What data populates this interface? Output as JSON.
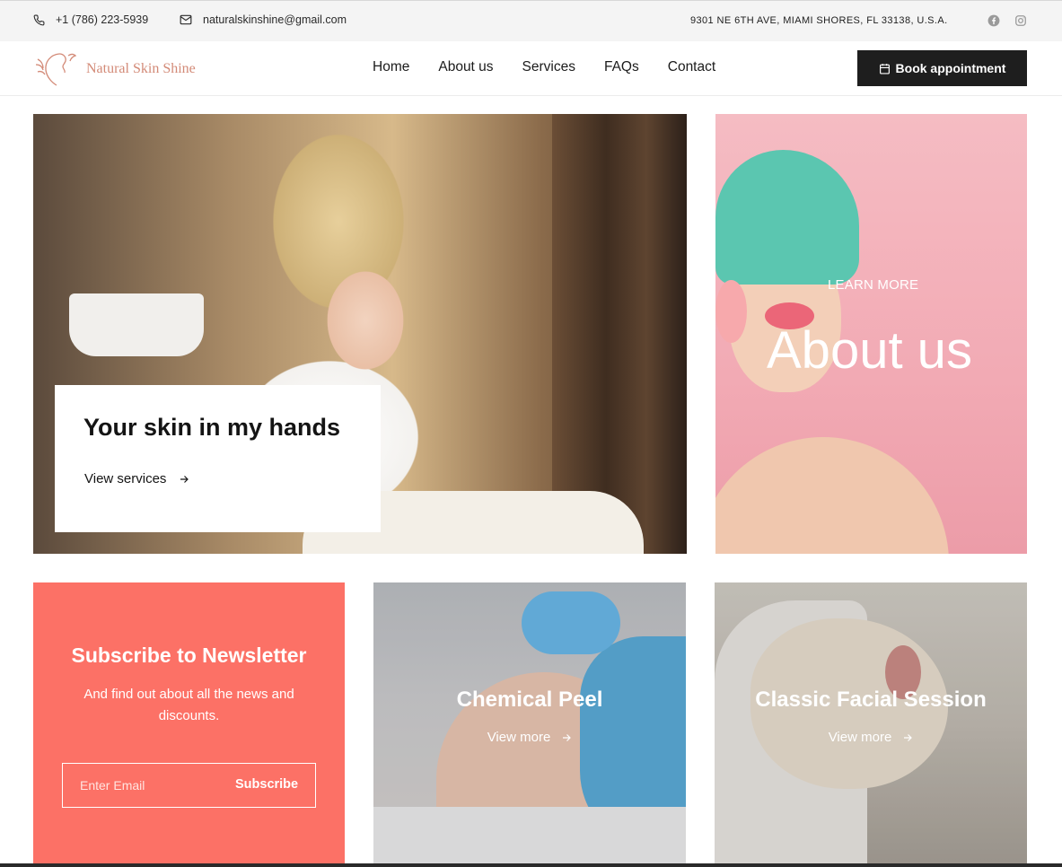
{
  "topbar": {
    "phone": "+1 (786) 223-5939",
    "email": "naturalskinshine@gmail.com",
    "address": "9301 NE 6TH AVE, MIAMI SHORES, FL 33138, U.S.A.",
    "icons": [
      "phone-icon",
      "mail-icon",
      "facebook-icon",
      "instagram-icon"
    ]
  },
  "header": {
    "logo_text": "Natural Skin Shine",
    "nav": [
      "Home",
      "About us",
      "Services",
      "FAQs",
      "Contact"
    ],
    "cta": "Book appointment"
  },
  "hero": {
    "title": "Your skin in my hands",
    "link": "View services"
  },
  "about": {
    "kicker": "LEARN MORE",
    "title": "About us"
  },
  "newsletter": {
    "title": "Subscribe to Newsletter",
    "subtitle": "And find out about all the news and discounts.",
    "placeholder": "Enter Email",
    "button": "Subscribe"
  },
  "services": [
    {
      "title": "Chemical Peel",
      "link": "View more"
    },
    {
      "title": "Classic Facial Session",
      "link": "View more"
    }
  ],
  "colors": {
    "accent": "#fc7166",
    "logo": "#d38a77",
    "dark": "#1e1e1e",
    "about_bg": "#f5bcc3"
  }
}
